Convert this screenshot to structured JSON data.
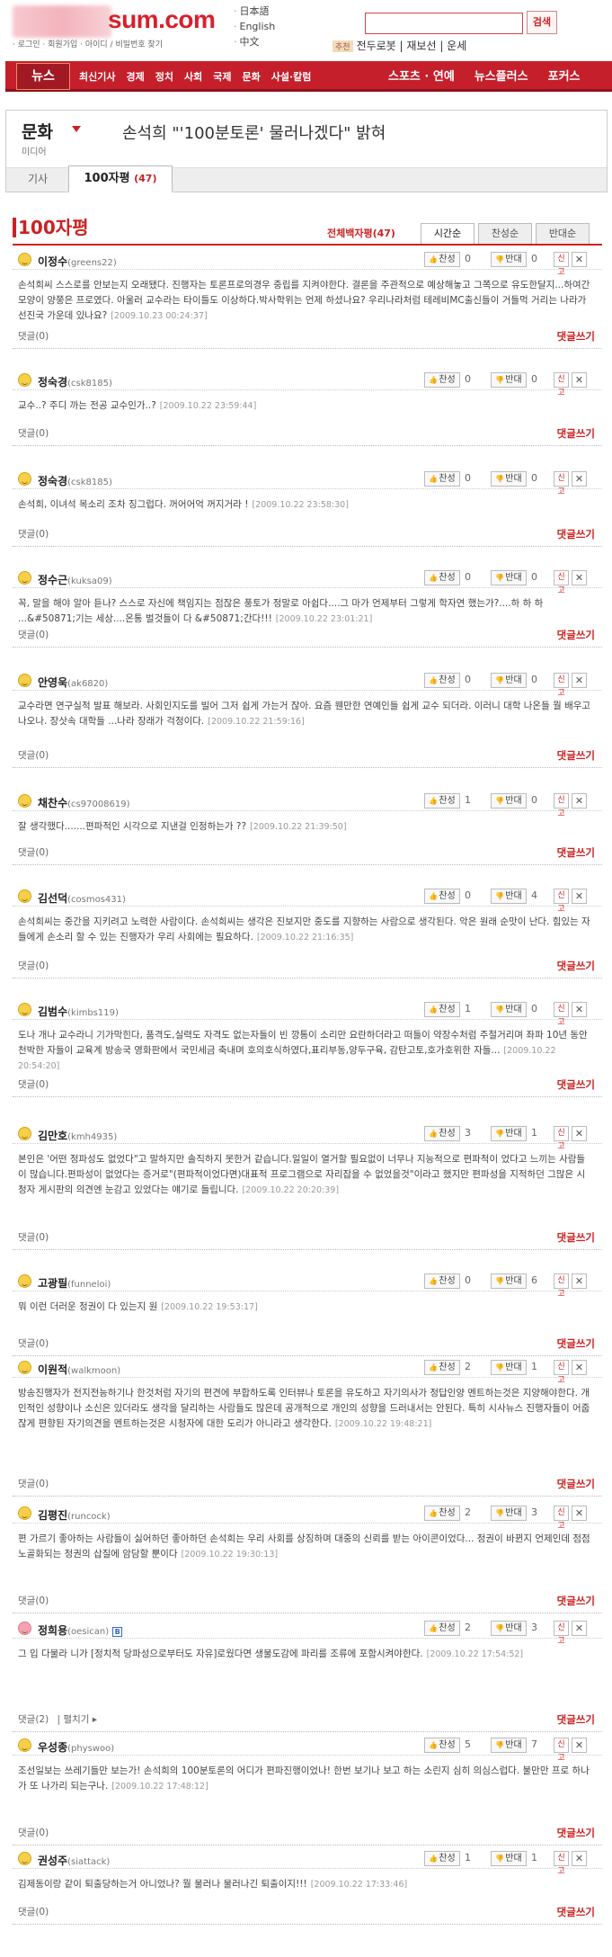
{
  "header": {
    "logo_text": "sum.com",
    "top_links": "· 로그인 · 회원가입 · 아이디 / 비밀번호 찾기",
    "languages": [
      "日本語",
      "English",
      "中文"
    ],
    "search_button": "검색",
    "search_tag": "추천",
    "search_links": "전두로봇 | 재보선 | 운세"
  },
  "nav": {
    "news": "뉴스",
    "items": [
      "최신기사",
      "경제",
      "정치",
      "사회",
      "국제",
      "문화",
      "사설·칼럼"
    ],
    "right": [
      "스포츠 · 연예",
      "뉴스플러스",
      "포커스"
    ]
  },
  "section": {
    "title": "문화",
    "subtitle": "미디어",
    "headline": "손석희 \"'100분토론' 물러나겠다\" 밝혀",
    "tab_article": "기사",
    "tab_comments": "100자평",
    "tab_comments_count": "(47)"
  },
  "comments_header": {
    "title": "100자평",
    "total": "전체백자평(47)",
    "sort": [
      "시간순",
      "찬성순",
      "반대순"
    ]
  },
  "labels": {
    "agree": "찬성",
    "oppose": "반대",
    "report": "신고",
    "delete": "✕",
    "write_reply": "댓글쓰기",
    "fold": "펼치기 ▸"
  },
  "comments": [
    {
      "name": "이정수",
      "id": "(greens22)",
      "agree": "0",
      "oppose": "0",
      "body": "손석희씨 스스로를 안보는지 오래됐다. 진행자는 토론프로의경우 중립를 지켜야한다. 결론을 주관적으로 예상해놓고 그쪽으로 유도한달지...하여간 모양이 양쭝은 프로였다. 아울러 교수라는 타이틀도 이상하다.박사학위는 언제 하셨나요? 우리나라처럼 테레비MC출신들이 거들먹 거리는 나라가 선진국 가운데 있나요?",
      "date": "[2009.10.23 00:24:37]",
      "reply": "댓글(0)"
    },
    {
      "name": "정숙경",
      "id": "(csk8185)",
      "agree": "0",
      "oppose": "0",
      "body": "교수..? 주디 까는 전공 교수인가..?",
      "date": "[2009.10.22 23:59:44]",
      "reply": "댓글(0)"
    },
    {
      "name": "정숙경",
      "id": "(csk8185)",
      "agree": "0",
      "oppose": "0",
      "body": "손석희, 이녀석 목소리 조차 징그럽다. 꺼어어억 꺼지거라 !",
      "date": "[2009.10.22 23:58:30]",
      "reply": "댓글(0)"
    },
    {
      "name": "정수근",
      "id": "(kuksa09)",
      "agree": "0",
      "oppose": "0",
      "body": "꼭, 말을 해야 알아 듣나? 스스로 자신에 책임지는 점잖은 풍토가 정말로 아쉽다....그 마가 언제부터 그렇게 학자연 했는가?....하 하 하 ...&#50871;기는 세상....온통 벌것들이 다 &#50871;간다!!!",
      "date": "[2009.10.22 23:01:21]",
      "reply": "댓글(0)"
    },
    {
      "name": "안영욱",
      "id": "(ak6820)",
      "agree": "0",
      "oppose": "0",
      "body": "교수라면 연구실적 발표 해보라. 사회인지도를 빌어 그저 쉽게 가는거 잖아. 요즘 웬만한 연예인들 쉽게 교수 되더라. 이러니 대학 나온들 뭘 배우고 나오나. 장삿속 대학들 ...나라 장래가 걱정이다.",
      "date": "[2009.10.22 21:59:16]",
      "reply": "댓글(0)"
    },
    {
      "name": "채찬수",
      "id": "(cs97008619)",
      "agree": "1",
      "oppose": "0",
      "body": "잘 생각했다.......편파적인 시각으로 지낸걸 인정하는가 ??",
      "date": "[2009.10.22 21:39:50]",
      "reply": "댓글(0)"
    },
    {
      "name": "김선덕",
      "id": "(cosmos431)",
      "agree": "0",
      "oppose": "4",
      "body": "손석희씨는 중간을 지키려고 노력한 사람이다. 손석희씨는 생각은 진보지만 중도를 지향하는 사람으로 생각된다. 악은 원래 순맛이 난다. 힘있는 자들에게 손소리 할 수 있는 진행자가 우리 사회에는 필요하다.",
      "date": "[2009.10.22 21:16:35]",
      "reply": "댓글(0)"
    },
    {
      "name": "김범수",
      "id": "(kimbs119)",
      "agree": "1",
      "oppose": "0",
      "body": "도나 개나 교수라니 기가막힌다, 품격도,실력도 자격도 없는자들이 빈 깡통이 소리만 요란하더라고 떠들이 약장수처럼 주절거리며 좌파 10년 동안 천박한 자들이 교육계 방송국 영화판에서 국민세금 축내며 호의호식하였다,표리부동,양두구육, 감탄고토,호가호위한 자들...",
      "date": "[2009.10.22 20:54:20]",
      "reply": "댓글(0)"
    },
    {
      "name": "김만호",
      "id": "(kmh4935)",
      "agree": "3",
      "oppose": "1",
      "body": "본인은 '어떤 정파성도 없었다\"고 말하지만 솔직하지 못한거 같습니다.일일이 열거할 필요없이 너무나 지능적으로 편파적이 었다고 느끼는 사람들이 많습니다.편파성이 없었다는 증거로\"(편파적이었다면)대표적 프로그램으로 자리잡을 수 없었을것\"이라고 했지만 편파성을 지적하던 그많은 시청자 게시판의 의견엔 눈감고 있었다는 얘기로 들립니다.",
      "date": "[2009.10.22 20:20:39]",
      "reply": "댓글(0)"
    },
    {
      "name": "고광필",
      "id": "(funneloi)",
      "agree": "0",
      "oppose": "6",
      "body": "뭐 이런 더러운 정권이 다 있는지 원",
      "date": "[2009.10.22 19:53:17]",
      "reply": "댓글(0)"
    },
    {
      "name": "이원적",
      "id": "(walkmoon)",
      "agree": "2",
      "oppose": "1",
      "body": "방송진행자가 전지전능하기나 한것처럼 자기의 편견에 부합하도록 인터뷰나 토론을 유도하고 자기의사가 정답인양 멘트하는것은 지양해야한다. 개인적인 성향이나 소신은 있더라도 생각을 달리하는 사람들도 많은데 공개적으로 개인의 성향을 드러내서는 안된다. 특히 시사뉴스 진행자들이 어줍잖게 편향된 자기의견을 멘트하는것은 시청자에 대한 도리가 아니라고 생각한다.",
      "date": "[2009.10.22 19:48:21]",
      "reply": "댓글(0)"
    },
    {
      "name": "김평진",
      "id": "(runcock)",
      "agree": "2",
      "oppose": "3",
      "body": "편 가르기 좋아하는 사람들이 싫어하던 좋아하던 손석희는 우리 사회를 상징하며 대중의 신뢰를 받는 아이콘이었다... 정권이 바뀐지 언제인데 점점 노골화되는 정권의 삽질에 암담할 뿐이다",
      "date": "[2009.10.22 19:30:13]",
      "reply": "댓글(0)"
    },
    {
      "name": "정희용",
      "id": "(oesican)",
      "badge": "B",
      "agree": "2",
      "oppose": "3",
      "body": "그 입 다물라 니가 [정치적 당파성으로부터도 자유]로웠다면 생물도감에 파리를 조류에 포함시켜야한다.",
      "date": "[2009.10.22 17:54:52]",
      "reply": "댓글(2)"
    },
    {
      "name": "우성종",
      "id": "(physwoo)",
      "agree": "5",
      "oppose": "7",
      "body": "조선일보는 쓰레기들만 보는가! 손석희의 100분토론의 어디가 편파진행이었나! 한번 보기나 보고 하는 소린지 심히 의심스럽다. 불만만 프로 하나가 또 나가리 되는구나.",
      "date": "[2009.10.22 17:48:12]",
      "reply": "댓글(0)"
    },
    {
      "name": "권성주",
      "id": "(siattack)",
      "agree": "1",
      "oppose": "1",
      "body": "김제동이랑 같이 퇴출당하는거 아니었나? 뭘 물러나 물러나긴 퇴출이지!!!",
      "date": "[2009.10.22 17:33:46]",
      "reply": "댓글(0)"
    }
  ]
}
